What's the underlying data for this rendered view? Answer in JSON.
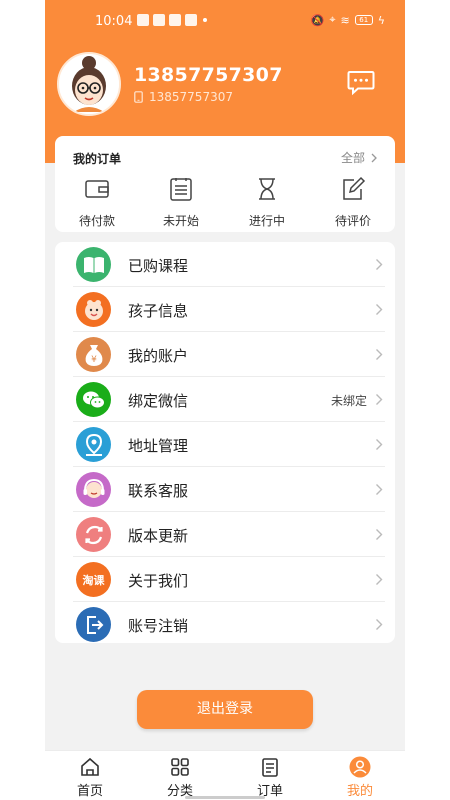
{
  "status_bar": {
    "time": "10:04",
    "battery": "61"
  },
  "profile": {
    "name": "13857757307",
    "phone": "13857757307"
  },
  "orders": {
    "title": "我的订单",
    "all_label": "全部",
    "items": [
      {
        "label": "待付款",
        "icon": "wallet-icon"
      },
      {
        "label": "未开始",
        "icon": "list-icon"
      },
      {
        "label": "进行中",
        "icon": "hourglass-icon"
      },
      {
        "label": "待评价",
        "icon": "edit-icon"
      }
    ]
  },
  "menu": {
    "items": [
      {
        "label": "已购课程",
        "icon": "book-icon",
        "color": "#3bb46e"
      },
      {
        "label": "孩子信息",
        "icon": "child-icon",
        "color": "#f36f21"
      },
      {
        "label": "我的账户",
        "icon": "money-bag-icon",
        "color": "#e0894b"
      },
      {
        "label": "绑定微信",
        "icon": "wechat-icon",
        "color": "#1aad19",
        "value": "未绑定"
      },
      {
        "label": "地址管理",
        "icon": "location-icon",
        "color": "#2a9fd6"
      },
      {
        "label": "联系客服",
        "icon": "service-icon",
        "color": "#c56ac8"
      },
      {
        "label": "版本更新",
        "icon": "refresh-icon",
        "color": "#ef7f7f"
      },
      {
        "label": "关于我们",
        "icon": "brand-logo-icon",
        "color": "#f36f21",
        "logo_text": "淘课"
      },
      {
        "label": "账号注销",
        "icon": "logout-icon",
        "color": "#2b6cb5"
      }
    ]
  },
  "logout_button": {
    "label": "退出登录"
  },
  "tabbar": {
    "tabs": [
      {
        "label": "首页",
        "icon": "home-icon"
      },
      {
        "label": "分类",
        "icon": "grid-icon"
      },
      {
        "label": "订单",
        "icon": "order-list-icon"
      },
      {
        "label": "我的",
        "icon": "user-icon",
        "active": true
      }
    ]
  },
  "colors": {
    "accent": "#fb8b3a",
    "background": "#f2f2f2"
  }
}
